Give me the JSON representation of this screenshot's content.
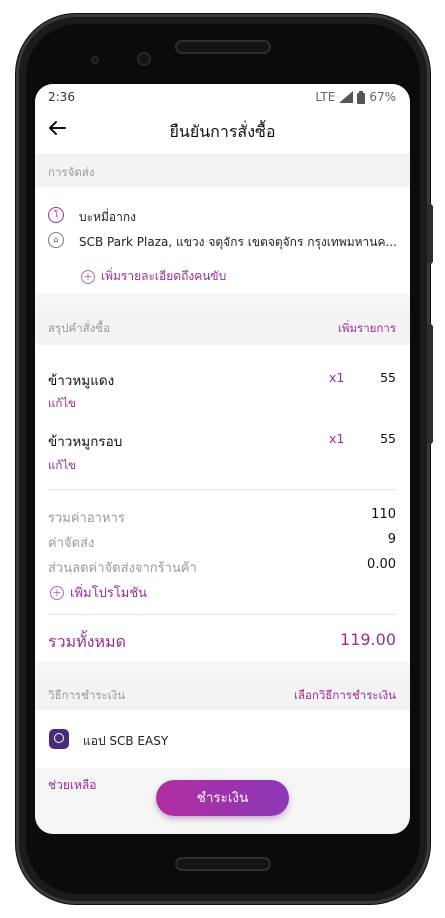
{
  "status_bar": {
    "time": "2:36",
    "network": "LTE",
    "battery": "67%"
  },
  "header": {
    "title": "ยืนยันการสั่งซื้อ",
    "back_icon": "arrow-left-icon"
  },
  "delivery": {
    "section_label": "การจัดส่ง",
    "restaurant": "บะหมี่อากง",
    "address": "SCB Park Plaza, แขวง จตุจักร เขตจตุจักร กรุงเทพมหานค...",
    "add_driver_note": "เพิ่มรายละเอียดถึงคนขับ"
  },
  "summary": {
    "section_label": "สรุปคำสั่งซื้อ",
    "add_items": "เพิ่มรายการ",
    "items": [
      {
        "name": "ข้าวหมูแดง",
        "qty": "x1",
        "price": "55",
        "edit": "แก้ไข"
      },
      {
        "name": "ข้าวหมูกรอบ",
        "qty": "x1",
        "price": "55",
        "edit": "แก้ไข"
      }
    ],
    "food_total_label": "รวมค่าอาหาร",
    "food_total": "110",
    "delivery_fee_label": "ค่าจัดส่ง",
    "delivery_fee": "9",
    "discount_label": "ส่วนลดค่าจัดส่งจากร้านค้า",
    "discount": "0.00",
    "add_promo": "เพิ่มโปรโมชัน",
    "grand_total_label": "รวมทั้งหมด",
    "grand_total": "119.00"
  },
  "payment": {
    "section_label": "วิธีการชำระเงิน",
    "choose_method": "เลือกวิธีการชำระเงิน",
    "method": "แอป SCB EASY",
    "method_icon_text": "SCB"
  },
  "footer": {
    "help": "ช่วยเหลือ",
    "pay_button": "ชำระเงิน"
  },
  "colors": {
    "accent": "#9c2d96",
    "button_start": "#b22ea2",
    "button_end": "#8c38b6"
  }
}
